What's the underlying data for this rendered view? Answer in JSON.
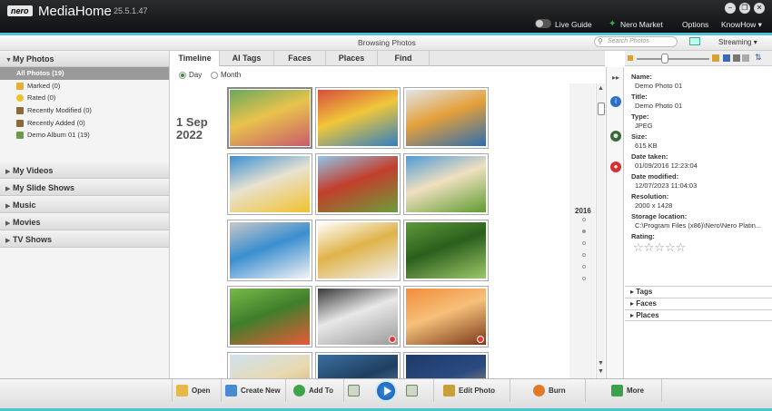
{
  "app": {
    "logo": "nero",
    "name": "MediaHome",
    "version": "25.5.1.47",
    "menu": {
      "live_guide": "Live Guide",
      "nero_market": "Nero Market",
      "options": "Options",
      "knowhow": "KnowHow"
    }
  },
  "header": {
    "title": "Browsing Photos",
    "search_placeholder": "Search Photos",
    "streaming": "Streaming"
  },
  "sidebar": {
    "my_photos": "My Photos",
    "photo_items": [
      {
        "label": "All Photos (19)",
        "icon": "all-photos-icon"
      },
      {
        "label": "Marked (0)",
        "icon": "flag-icon"
      },
      {
        "label": "Rated (0)",
        "icon": "star-icon"
      },
      {
        "label": "Recently Modified (0)",
        "icon": "recent-modified-icon"
      },
      {
        "label": "Recently Added (0)",
        "icon": "recent-added-icon"
      },
      {
        "label": "Demo Album 01 (19)",
        "icon": "album-icon"
      }
    ],
    "sections": [
      "My Videos",
      "My Slide Shows",
      "Music",
      "Movies",
      "TV Shows"
    ]
  },
  "tabs": [
    "Timeline",
    "AI Tags",
    "Faces",
    "Places",
    "Find"
  ],
  "view_modes": [
    "Day",
    "Month"
  ],
  "photos": {
    "date_line1": "1 Sep",
    "date_line2": "2022",
    "thumbnails": [
      {
        "name": "school-kids",
        "colors": [
          "#6aa85c",
          "#c95a6b",
          "#e9c34d"
        ],
        "selected": true
      },
      {
        "name": "kids-group",
        "colors": [
          "#d84d3d",
          "#2f7fc1",
          "#f0c73a"
        ]
      },
      {
        "name": "kids-classroom",
        "colors": [
          "#e0e5ea",
          "#2e6db0",
          "#e5a03b"
        ]
      },
      {
        "name": "kids-drawing",
        "colors": [
          "#3b8fd3",
          "#f2c12e",
          "#e8e2d0"
        ]
      },
      {
        "name": "kids-running-field",
        "colors": [
          "#8fc6e8",
          "#6a9f3a",
          "#c33e2c"
        ]
      },
      {
        "name": "kids-playing-grass",
        "colors": [
          "#4f9ad6",
          "#5f9c30",
          "#f0e0c0"
        ]
      },
      {
        "name": "karate-kids-1",
        "colors": [
          "#c8c8c8",
          "#f4f4f4",
          "#3a8ed0"
        ]
      },
      {
        "name": "karate-kids-2",
        "colors": [
          "#ffffff",
          "#f0f0f0",
          "#e0b34a"
        ]
      },
      {
        "name": "kids-soccer",
        "colors": [
          "#5d9a3a",
          "#9ec86a",
          "#2a5f1c"
        ]
      },
      {
        "name": "kids-ball",
        "colors": [
          "#7ab84a",
          "#e85a3a",
          "#3f7f2a"
        ]
      },
      {
        "name": "mountain-snow",
        "colors": [
          "#3a3a3a",
          "#9a9a9a",
          "#e8e8e8"
        ],
        "pin": true
      },
      {
        "name": "desert-sunset",
        "colors": [
          "#f28c3a",
          "#7a3a1a",
          "#f6c07a"
        ],
        "pin": true
      },
      {
        "name": "giraffes",
        "colors": [
          "#cfe2f0",
          "#c89a5a",
          "#e9d9b0"
        ]
      },
      {
        "name": "coastal-cliffs",
        "colors": [
          "#3a6fa0",
          "#6fa0c8",
          "#1f3f60"
        ]
      },
      {
        "name": "gate-night",
        "colors": [
          "#1f3a6a",
          "#e0b070",
          "#2a4a80"
        ]
      }
    ]
  },
  "timeline": {
    "year": "2016"
  },
  "properties": {
    "fields": [
      {
        "label": "Name:",
        "value": "Demo Photo 01"
      },
      {
        "label": "Title:",
        "value": "Demo Photo 01"
      },
      {
        "label": "Type:",
        "value": "JPEG"
      },
      {
        "label": "Size:",
        "value": "615 KB"
      },
      {
        "label": "Date taken:",
        "value": "01/09/2016 12:23:04"
      },
      {
        "label": "Date modified:",
        "value": "12/07/2023 11:04:03"
      },
      {
        "label": "Resolution:",
        "value": "2000 x 1428"
      },
      {
        "label": "Storage location:",
        "value": "C:\\Program Files (x86)\\Nero\\Nero Platin..."
      },
      {
        "label": "Rating:",
        "value": ""
      }
    ],
    "rating_stars": 5,
    "rating_value": 0,
    "accordions": [
      "Tags",
      "Faces",
      "Places"
    ]
  },
  "bottom_toolbar": {
    "buttons": [
      {
        "label": "Open",
        "icon": "open-icon",
        "color": "#e6b84a"
      },
      {
        "label": "Create New",
        "icon": "create-new-icon",
        "color": "#4a8ad0"
      },
      {
        "label": "Add To",
        "icon": "add-to-icon",
        "color": "#3fa34a"
      },
      {
        "label": "Edit Photo",
        "icon": "edit-photo-icon",
        "color": "#c8a03a"
      },
      {
        "label": "Burn",
        "icon": "burn-icon",
        "color": "#e07a2a"
      },
      {
        "label": "More",
        "icon": "more-icon",
        "color": "#3aa34a"
      }
    ]
  },
  "colors": {
    "accent": "#4fc3d3",
    "titlebar": "#1a1b1c",
    "selected_sidebar": "#9a9a9a"
  }
}
